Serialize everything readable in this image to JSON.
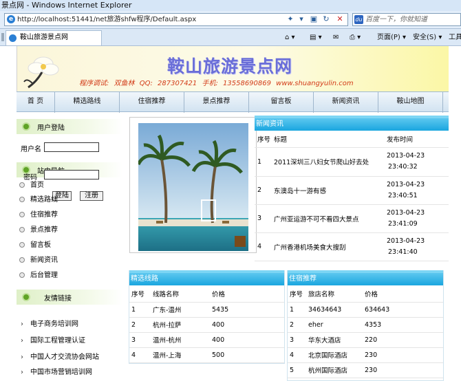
{
  "browser": {
    "title": "景点网 - Windows Internet Explorer",
    "address": "http://localhost:51441/net旅游shfw程序/Default.aspx",
    "search_placeholder": "百度一下，你就知道",
    "tab_label": "鞍山旅游景点网",
    "toolbar": {
      "page": "页面(P)",
      "safety": "安全(S)",
      "tools": "工具"
    }
  },
  "site": {
    "title": "鞍山旅游景点网",
    "contact": "程序调试: 双鱼林  QQ: 287307421  手机: 13558690869  www.shuangyulin.com"
  },
  "nav": [
    "首 页",
    "精选路线",
    "住宿推荐",
    "景点推荐",
    "留言板",
    "新闻资讯",
    "鞍山地图"
  ],
  "login": {
    "heading": "用户登陆",
    "username_label": "用户名",
    "password_label": "密码",
    "login_button": "登陆",
    "register_button": "注册"
  },
  "site_nav": {
    "heading": "站内导航",
    "items": [
      "首页",
      "精选路线",
      "住宿推荐",
      "景点推荐",
      "留言板",
      "新闻资讯",
      "后台管理"
    ]
  },
  "friends": {
    "heading": "友情链接",
    "items": [
      "电子商务培训网",
      "国际工程管理认证",
      "中国人才交流协会网站",
      "中国市场营销培训网"
    ]
  },
  "news": {
    "heading": "新闻资讯",
    "columns": [
      "序号",
      "标题",
      "发布时间"
    ],
    "rows": [
      {
        "no": "1",
        "title": "2011深圳三八妇女节爬山好去处",
        "date": "2013-04-23",
        "time": "23:40:32"
      },
      {
        "no": "2",
        "title": "东澳岛十一游有感",
        "date": "2013-04-23",
        "time": "23:40:51"
      },
      {
        "no": "3",
        "title": "广州亚运游不可不看四大景点",
        "date": "2013-04-23",
        "time": "23:41:09"
      },
      {
        "no": "4",
        "title": "广州香港机场美食大搜刮",
        "date": "2013-04-23",
        "time": "23:41:40"
      }
    ]
  },
  "routes": {
    "heading": "精选线路",
    "columns": [
      "序号",
      "线路名称",
      "价格"
    ],
    "rows": [
      {
        "no": "1",
        "name": "广东-温州",
        "price": "5435"
      },
      {
        "no": "2",
        "name": "杭州-拉萨",
        "price": "400"
      },
      {
        "no": "3",
        "name": "温州-杭州",
        "price": "400"
      },
      {
        "no": "4",
        "name": "温州-上海",
        "price": "500"
      }
    ]
  },
  "hotels": {
    "heading": "住宿推荐",
    "columns": [
      "序号",
      "旅店名称",
      "价格"
    ],
    "rows": [
      {
        "no": "1",
        "name": "34634643",
        "price": "634643"
      },
      {
        "no": "2",
        "name": "eher",
        "price": "4353"
      },
      {
        "no": "3",
        "name": "华东大酒店",
        "price": "220"
      },
      {
        "no": "4",
        "name": "北京国际酒店",
        "price": "230"
      },
      {
        "no": "5",
        "name": "杭州国际酒店",
        "price": "230"
      }
    ]
  },
  "colors": {
    "section_header": "#1aa6df",
    "title": "#6a6ed8",
    "contact": "#d23a17"
  }
}
